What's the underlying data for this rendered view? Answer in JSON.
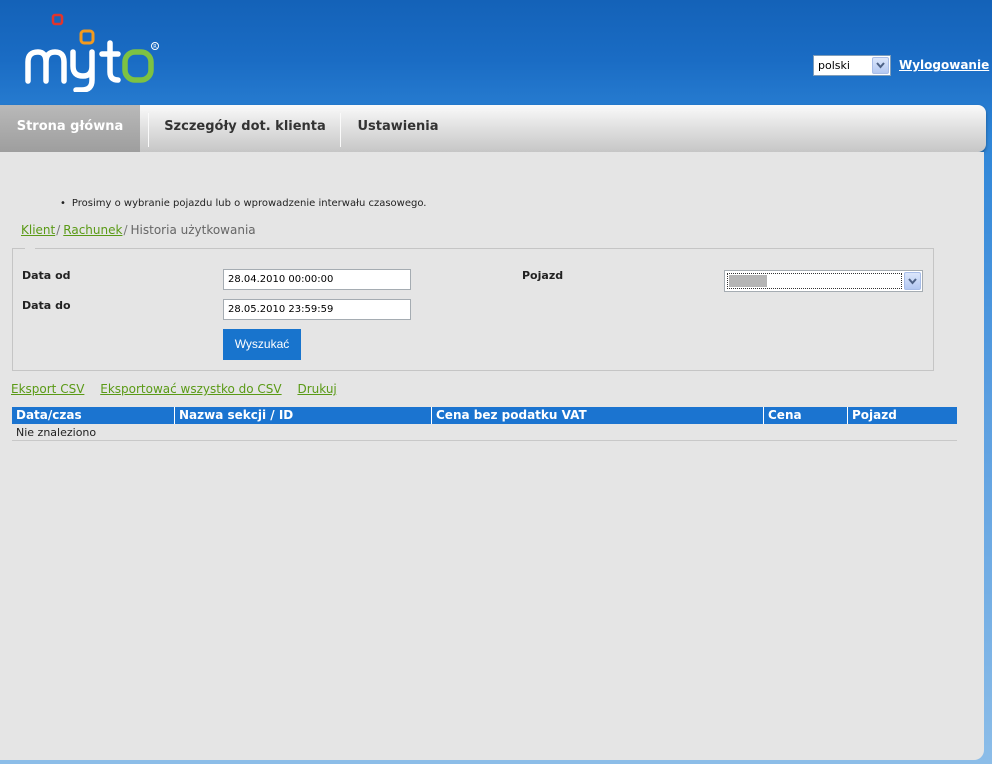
{
  "header": {
    "brand": "myto",
    "language": "polski",
    "logout_label": "Wylogowanie"
  },
  "nav": {
    "items": [
      {
        "label": "Strona główna",
        "active": true
      },
      {
        "label": "Szczegóły dot. klienta",
        "active": false
      },
      {
        "label": "Ustawienia",
        "active": false
      }
    ]
  },
  "notice": "Prosimy o wybranie pojazdu lub o wprowadzenie interwału czasowego.",
  "breadcrumb": {
    "items": [
      "Klient",
      "Rachunek",
      "Historia użytkowania"
    ]
  },
  "form": {
    "date_from_label": "Data od",
    "date_from_value": "28.04.2010 00:00:00",
    "date_to_label": "Data do",
    "date_to_value": "28.05.2010 23:59:59",
    "vehicle_label": "Pojazd",
    "search_label": "Wyszukać"
  },
  "export": {
    "csv_label": "Eksport CSV",
    "csv_all_label": "Eksportować wszystko do CSV",
    "print_label": "Drukuj"
  },
  "table": {
    "columns": [
      "Data/czas",
      "Nazwa sekcji / ID",
      "Cena bez podatku VAT",
      "Cena",
      "Pojazd"
    ],
    "empty_text": "Nie znaleziono"
  },
  "colors": {
    "brand_blue": "#1b74d0",
    "link_green": "#5a9a16",
    "logo_orange": "#f39a1e",
    "logo_green": "#7dc242",
    "logo_red": "#e2342c"
  }
}
